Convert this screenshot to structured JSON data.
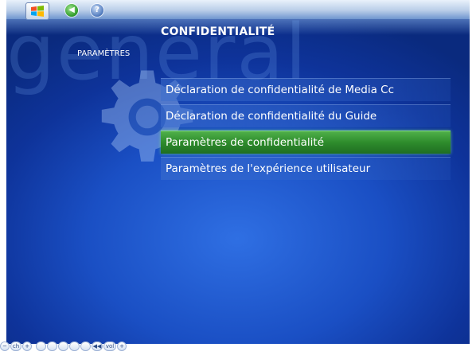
{
  "header": {
    "watermark": "general",
    "title": "CONFIDENTIALITÉ",
    "section": "PARAMÈTRES"
  },
  "nav": {
    "start_icon": "windows-logo-icon",
    "back_icon": "back-arrow-icon",
    "help_icon": "help-icon"
  },
  "menu": {
    "items": [
      {
        "label": "Déclaration de confidentialité de Media Cc",
        "selected": false
      },
      {
        "label": "Déclaration de confidentialité du Guide",
        "selected": false
      },
      {
        "label": "Paramètres de confidentialité",
        "selected": true
      },
      {
        "label": "Paramètres de l'expérience utilisateur",
        "selected": false
      }
    ]
  },
  "transport": {
    "labels": [
      "−",
      "ch",
      "+",
      "",
      "",
      "",
      "",
      "",
      "◀◀",
      "vol",
      "+"
    ]
  },
  "colors": {
    "background": "#1a4fc4",
    "selected": "#2e8c2c",
    "text": "#ffffff"
  }
}
